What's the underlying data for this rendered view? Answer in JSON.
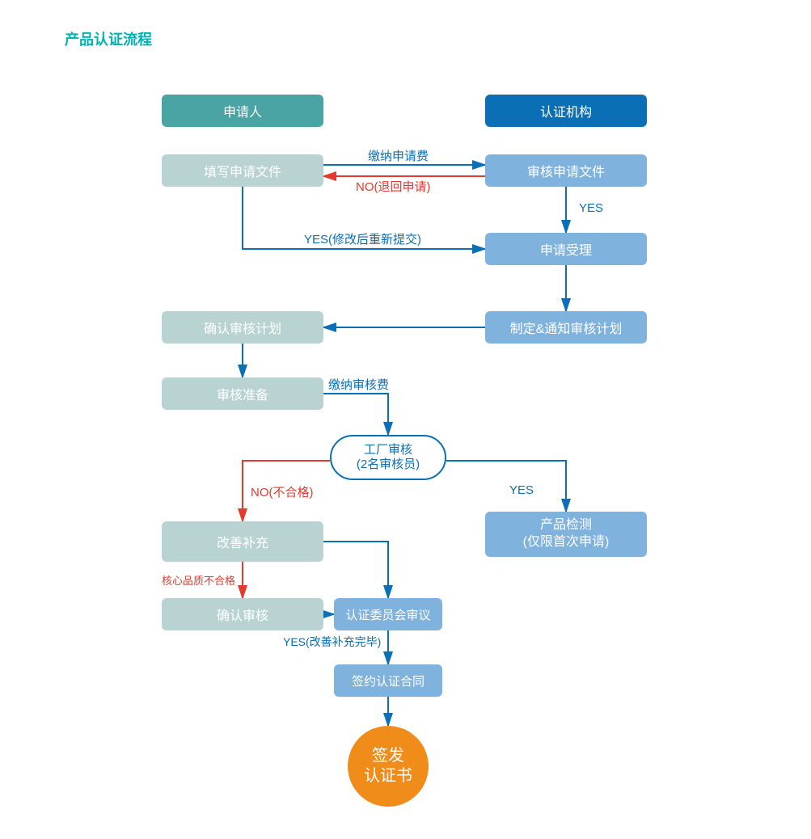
{
  "title": "产品认证流程",
  "colors": {
    "title": "#00b3b3",
    "applicant_header": "#4aa4a4",
    "agency_header": "#0a6fb5",
    "applicant_box": "#b9d3d3",
    "agency_box": "#7fb3dd",
    "circle": "#f08c1a",
    "arrow_blue": "#0a6fb5",
    "arrow_red": "#e33a2e",
    "text_white": "#ffffff",
    "text_blue": "#0a6fb5",
    "text_red": "#e33a2e"
  },
  "nodes": {
    "col_left": {
      "header": "申请人"
    },
    "col_right": {
      "header": "认证机构"
    },
    "L1": "填写申请文件",
    "R1": "审核申请文件",
    "R2": "申请受理",
    "R3": "制定&通知审核计划",
    "L3": "确认审核计划",
    "L4": "审核准备",
    "C5": {
      "line1": "工厂审核",
      "line2": "(2名审核员)"
    },
    "L6": "改善补充",
    "R6": {
      "line1": "产品检测",
      "line2": "(仅限首次申请)"
    },
    "L7": "确认审核",
    "C7": "认证委员会审议",
    "C8": "签约认证合同",
    "C9": {
      "line1": "签发",
      "line2": "认证书"
    }
  },
  "edges": {
    "e_L1_R1_top": "缴纳申请费",
    "e_R1_L1_no": "NO(退回申请)",
    "e_R1_R2_yes": "YES",
    "e_L1_R2_yes": "YES(修改后重新提交)",
    "e_L4_C5_fee": "缴纳审核费",
    "e_C5_L6_no": "NO(不合格)",
    "e_C5_R6_yes": "YES",
    "e_L6_L7_fail": "核心品质不合格",
    "e_L7_C7_yes": "YES(改善补充完毕)"
  }
}
